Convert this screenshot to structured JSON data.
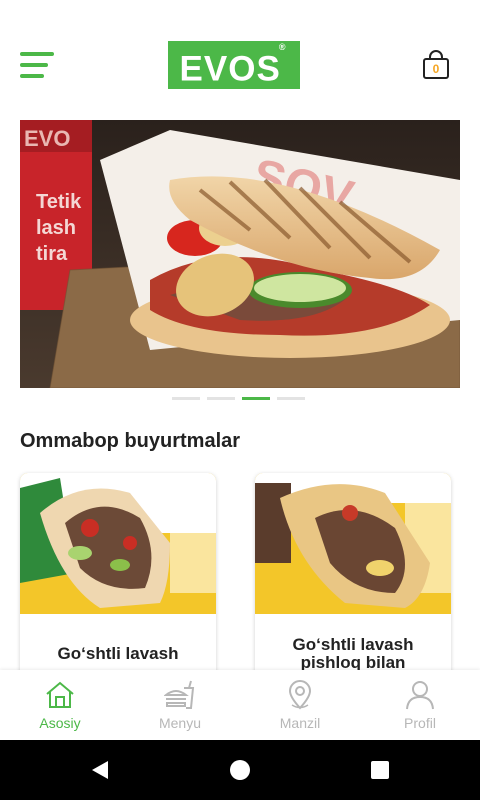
{
  "app": {
    "brand": "EVOS",
    "brand_mark": "®",
    "accent": "#4cb848"
  },
  "header": {
    "cart_count": "0"
  },
  "banner": {
    "slides_total": 4,
    "active_slide": 3,
    "cup_text": [
      "Tetik",
      "lash",
      "tira"
    ]
  },
  "popular": {
    "title": "Ommabop buyurtmalar",
    "items": [
      {
        "name": "Go‘shtli lavash"
      },
      {
        "name": "Go‘shtli lavash pishloq bilan"
      }
    ]
  },
  "bottom_nav": {
    "items": [
      {
        "label": "Asosiy",
        "icon": "home-icon",
        "active": true
      },
      {
        "label": "Menyu",
        "icon": "fastfood-icon",
        "active": false
      },
      {
        "label": "Manzil",
        "icon": "map-pin-icon",
        "active": false
      },
      {
        "label": "Profil",
        "icon": "user-icon",
        "active": false
      }
    ]
  },
  "system_nav": {
    "icons": [
      "back-icon",
      "home-circle-icon",
      "recents-icon"
    ]
  }
}
